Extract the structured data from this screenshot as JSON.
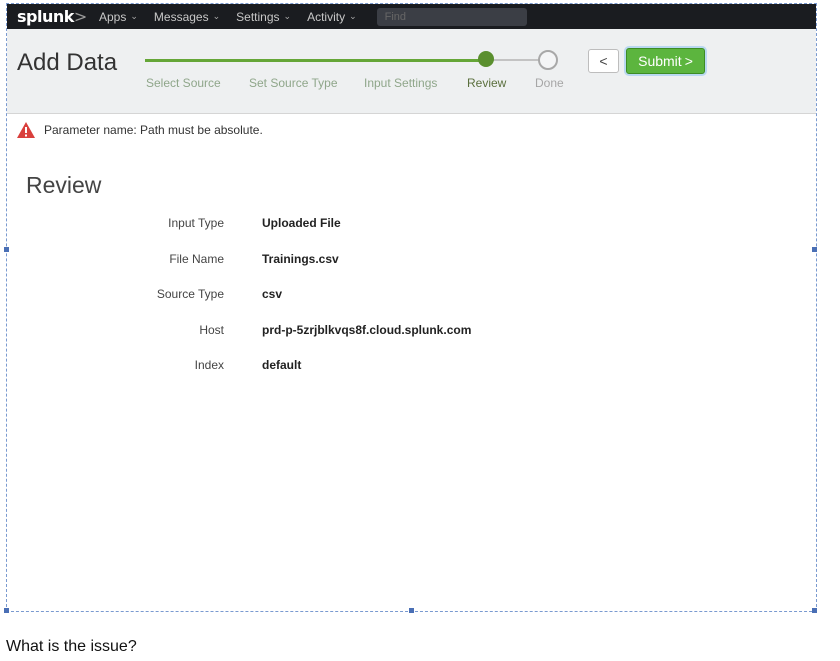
{
  "topbar": {
    "logo_text": "splunk",
    "logo_suffix": ">",
    "nav": [
      {
        "label": "Apps"
      },
      {
        "label": "Messages"
      },
      {
        "label": "Settings"
      },
      {
        "label": "Activity"
      }
    ],
    "find_placeholder": "Find"
  },
  "header": {
    "title": "Add Data",
    "steps": [
      {
        "label": "Select Source",
        "state": "completed"
      },
      {
        "label": "Set Source Type",
        "state": "completed"
      },
      {
        "label": "Input Settings",
        "state": "completed"
      },
      {
        "label": "Review",
        "state": "current"
      },
      {
        "label": "Done",
        "state": "pending"
      }
    ],
    "back_label": "<",
    "submit_label": "Submit",
    "submit_chevron": ">"
  },
  "alert": {
    "message": "Parameter name: Path must be absolute.",
    "icon": "warning-triangle-icon",
    "color": "#d93f3c"
  },
  "review": {
    "title": "Review",
    "rows": [
      {
        "key": "Input Type",
        "value": "Uploaded File"
      },
      {
        "key": "File Name",
        "value": "Trainings.csv"
      },
      {
        "key": "Source Type",
        "value": "csv"
      },
      {
        "key": "Host",
        "value": "prd-p-5zrjblkvqs8f.cloud.splunk.com"
      },
      {
        "key": "Index",
        "value": "default"
      }
    ]
  },
  "question": "What is the issue?",
  "colors": {
    "topbar_bg": "#1a1c20",
    "progress_green": "#65a637",
    "submit_green": "#5cb53e"
  }
}
